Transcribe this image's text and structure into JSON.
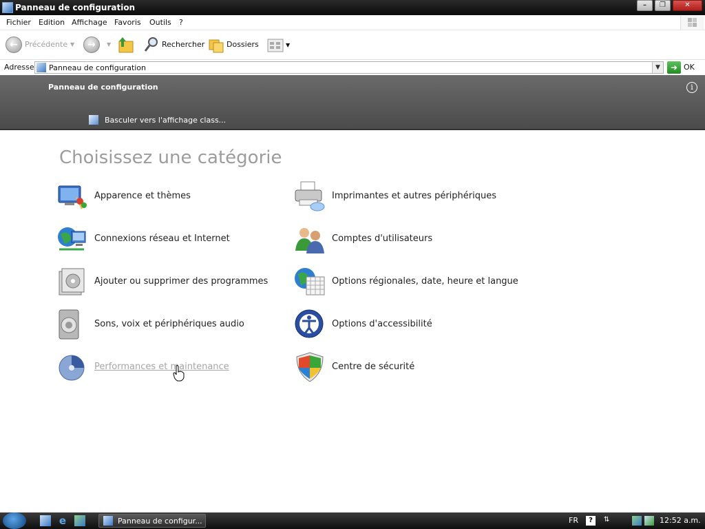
{
  "window": {
    "title": "Panneau de configuration",
    "controls": [
      "minimize",
      "restore",
      "close"
    ]
  },
  "menu": [
    "Fichier",
    "Edition",
    "Affichage",
    "Favoris",
    "Outils",
    "?"
  ],
  "toolbar": {
    "back_label": "Précédente",
    "search_label": "Rechercher",
    "folders_label": "Dossiers"
  },
  "address": {
    "label": "Adresse",
    "value": "Panneau de configuration",
    "go_label": "OK"
  },
  "banner": {
    "title": "Panneau de configuration",
    "switch_link": "Basculer vers l'affichage class..."
  },
  "main": {
    "heading": "Choisissez une catégorie",
    "categories_left": [
      {
        "label": "Apparence et thèmes",
        "icon": "appearance-icon"
      },
      {
        "label": "Connexions réseau et Internet",
        "icon": "network-icon"
      },
      {
        "label": "Ajouter ou supprimer des programmes",
        "icon": "programs-icon"
      },
      {
        "label": "Sons, voix et périphériques audio",
        "icon": "sound-icon"
      },
      {
        "label": "Performances et maintenance",
        "icon": "performance-icon"
      }
    ],
    "categories_right": [
      {
        "label": "Imprimantes et autres périphériques",
        "icon": "printer-icon"
      },
      {
        "label": "Comptes d'utilisateurs",
        "icon": "users-icon"
      },
      {
        "label": "Options régionales, date, heure et langue",
        "icon": "regional-icon"
      },
      {
        "label": "Options d'accessibilité",
        "icon": "accessibility-icon"
      },
      {
        "label": "Centre de sécurité",
        "icon": "security-shield-icon"
      }
    ]
  },
  "taskbar": {
    "task_label": "Panneau de configur...",
    "language": "FR",
    "clock": "12:52 a.m."
  }
}
